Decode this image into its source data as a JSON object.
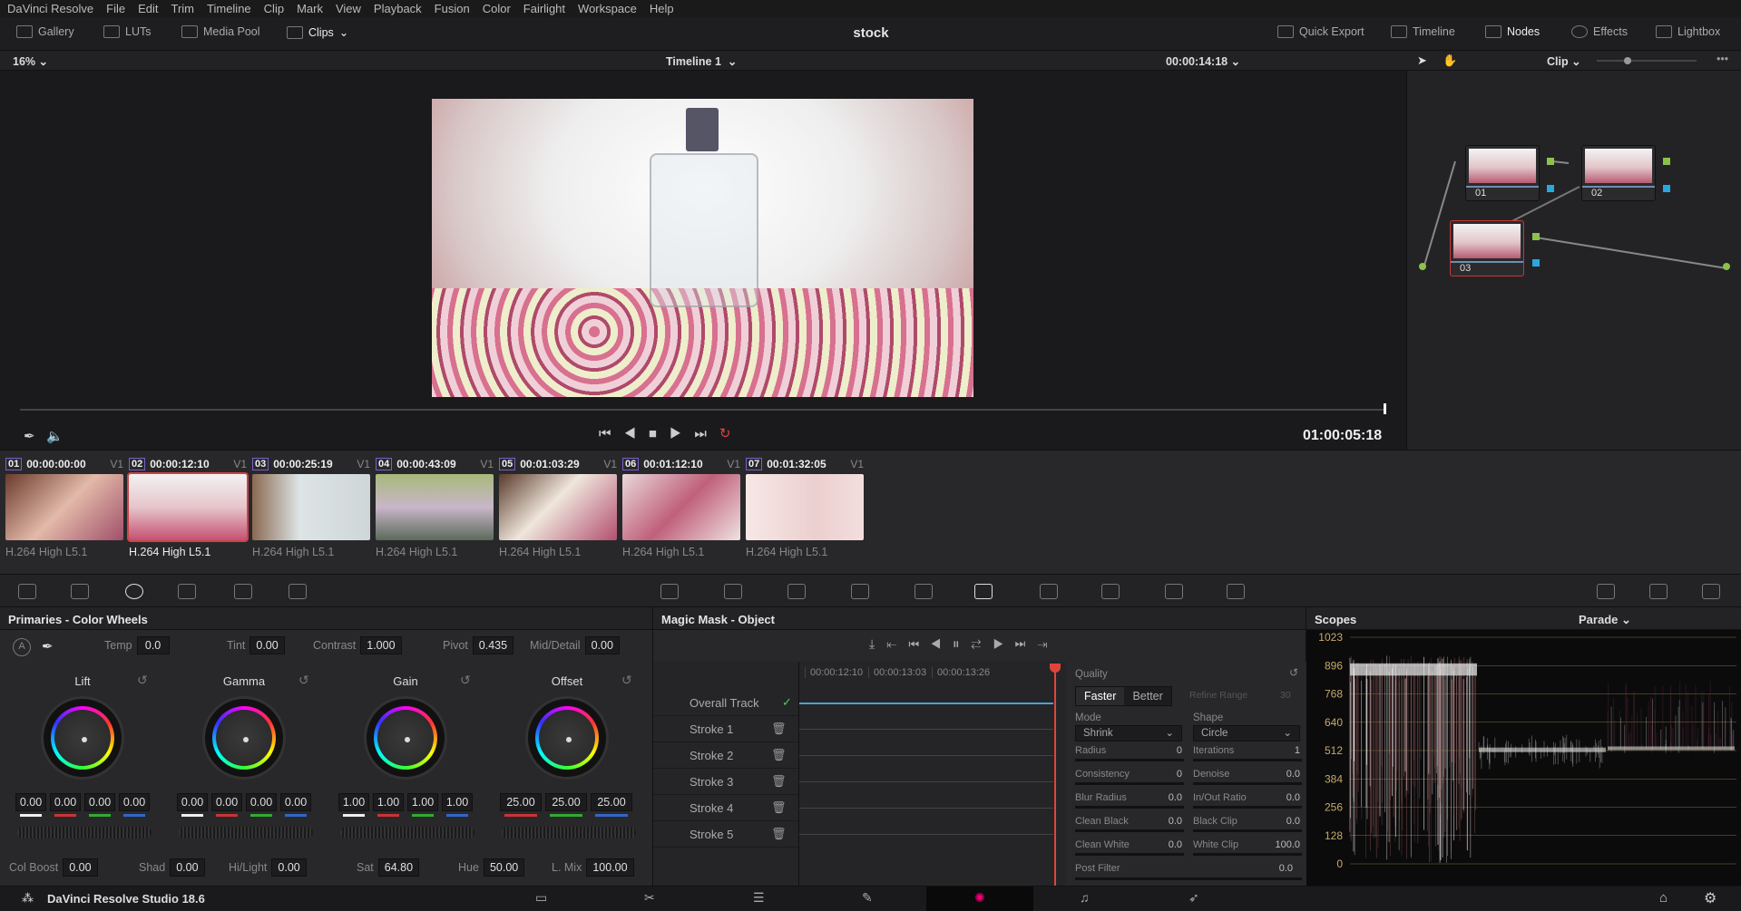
{
  "menu": [
    "DaVinci Resolve",
    "File",
    "Edit",
    "Trim",
    "Timeline",
    "Clip",
    "Mark",
    "View",
    "Playback",
    "Fusion",
    "Color",
    "Fairlight",
    "Workspace",
    "Help"
  ],
  "toolbar": {
    "left": [
      "Gallery",
      "LUTs",
      "Media Pool",
      "Clips"
    ],
    "right": [
      "Quick Export",
      "Timeline",
      "Nodes",
      "Effects",
      "Lightbox"
    ],
    "project_title": "stock"
  },
  "viewer": {
    "zoom": "16%",
    "timeline_name": "Timeline 1",
    "source_timecode": "00:00:14:18",
    "node_mode": "Clip",
    "record_timecode": "01:00:05:18"
  },
  "nodes": [
    {
      "id": "01"
    },
    {
      "id": "02"
    },
    {
      "id": "03"
    }
  ],
  "clips": [
    {
      "num": "01",
      "tc": "00:00:00:00",
      "track": "V1",
      "codec": "H.264 High L5.1"
    },
    {
      "num": "02",
      "tc": "00:00:12:10",
      "track": "V1",
      "codec": "H.264 High L5.1",
      "selected": true
    },
    {
      "num": "03",
      "tc": "00:00:25:19",
      "track": "V1",
      "codec": "H.264 High L5.1"
    },
    {
      "num": "04",
      "tc": "00:00:43:09",
      "track": "V1",
      "codec": "H.264 High L5.1"
    },
    {
      "num": "05",
      "tc": "00:01:03:29",
      "track": "V1",
      "codec": "H.264 High L5.1"
    },
    {
      "num": "06",
      "tc": "00:01:12:10",
      "track": "V1",
      "codec": "H.264 High L5.1"
    },
    {
      "num": "07",
      "tc": "00:01:32:05",
      "track": "V1",
      "codec": "H.264 High L5.1"
    }
  ],
  "primaries": {
    "title": "Primaries - Color Wheels",
    "top": [
      {
        "label": "Temp",
        "value": "0.0"
      },
      {
        "label": "Tint",
        "value": "0.00"
      },
      {
        "label": "Contrast",
        "value": "1.000"
      },
      {
        "label": "Pivot",
        "value": "0.435"
      },
      {
        "label": "Mid/Detail",
        "value": "0.00"
      }
    ],
    "wheels": [
      {
        "label": "Lift",
        "values": [
          "0.00",
          "0.00",
          "0.00",
          "0.00"
        ]
      },
      {
        "label": "Gamma",
        "values": [
          "0.00",
          "0.00",
          "0.00",
          "0.00"
        ]
      },
      {
        "label": "Gain",
        "values": [
          "1.00",
          "1.00",
          "1.00",
          "1.00"
        ]
      },
      {
        "label": "Offset",
        "values": [
          "25.00",
          "25.00",
          "25.00"
        ]
      }
    ],
    "bottom": [
      {
        "label": "Col Boost",
        "value": "0.00"
      },
      {
        "label": "Shad",
        "value": "0.00"
      },
      {
        "label": "Hi/Light",
        "value": "0.00"
      },
      {
        "label": "Sat",
        "value": "64.80"
      },
      {
        "label": "Hue",
        "value": "50.00"
      },
      {
        "label": "L. Mix",
        "value": "100.00"
      }
    ]
  },
  "magic_mask": {
    "title": "Magic Mask - Object",
    "ruler": [
      "00:00:12:10",
      "00:00:13:03",
      "00:00:13:26"
    ],
    "tracks": [
      "Overall Track",
      "Stroke 1",
      "Stroke 2",
      "Stroke 3",
      "Stroke 4",
      "Stroke 5"
    ],
    "quality_label": "Quality",
    "quality_options": [
      "Faster",
      "Better"
    ],
    "refine_range": {
      "label": "Refine Range",
      "value": "30"
    },
    "mode": {
      "label": "Mode",
      "value": "Shrink"
    },
    "shape": {
      "label": "Shape",
      "value": "Circle"
    },
    "params": [
      {
        "label": "Radius",
        "value": "0"
      },
      {
        "label": "Iterations",
        "value": "1"
      },
      {
        "label": "Consistency",
        "value": "0"
      },
      {
        "label": "Denoise",
        "value": "0.0"
      },
      {
        "label": "Blur Radius",
        "value": "0.0"
      },
      {
        "label": "In/Out Ratio",
        "value": "0.0"
      },
      {
        "label": "Clean Black",
        "value": "0.0"
      },
      {
        "label": "Black Clip",
        "value": "0.0"
      },
      {
        "label": "Clean White",
        "value": "0.0"
      },
      {
        "label": "White Clip",
        "value": "100.0"
      }
    ],
    "post_filter": {
      "label": "Post Filter",
      "value": "0.0"
    }
  },
  "scopes": {
    "title": "Scopes",
    "mode": "Parade",
    "ticks": [
      "1023",
      "896",
      "768",
      "640",
      "512",
      "384",
      "256",
      "128",
      "0"
    ]
  },
  "app": {
    "name": "DaVinci Resolve Studio 18.6"
  },
  "colors": {
    "accent_red": "#e0453a",
    "node_green": "#8bc34a",
    "node_blue": "#29a8e0",
    "scope_grid": "#b39a50"
  }
}
